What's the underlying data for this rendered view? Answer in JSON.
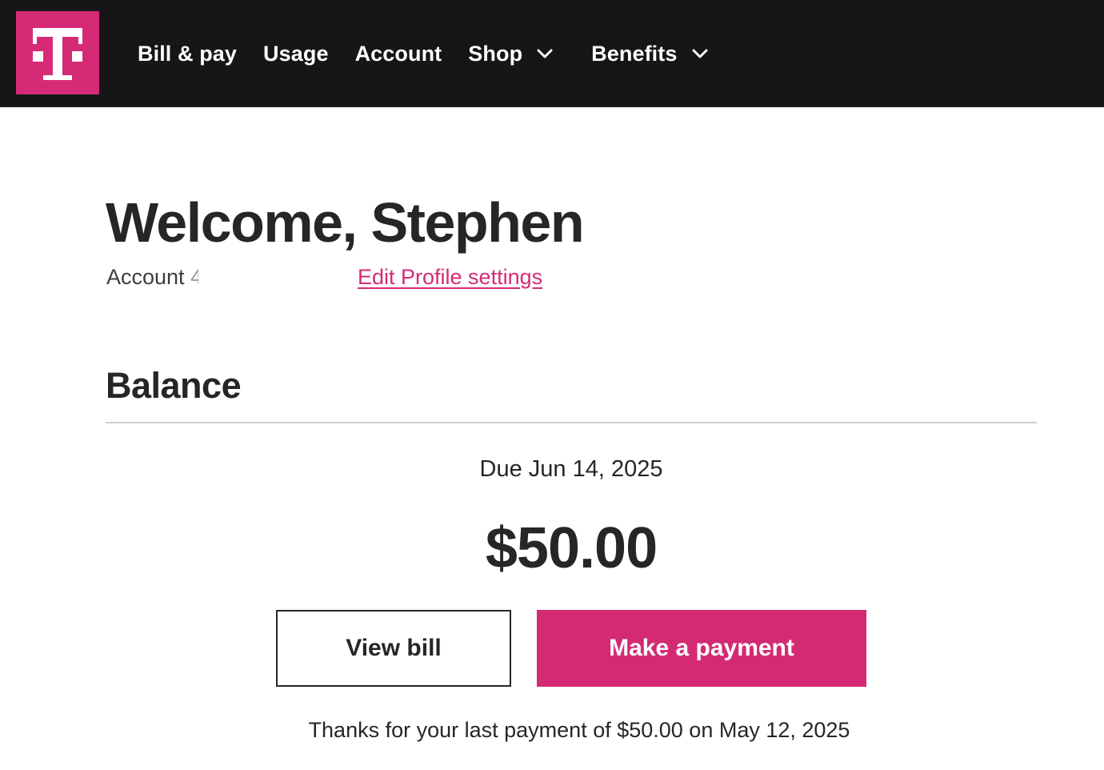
{
  "colors": {
    "brand_magenta": "#d62a77",
    "header_background": "#161616",
    "text_dark": "#262626",
    "divider": "#cfcfcf"
  },
  "header": {
    "logo_icon": "t-mobile-logo",
    "nav": {
      "bill_pay": "Bill & pay",
      "usage": "Usage",
      "account": "Account",
      "shop": "Shop",
      "benefits": "Benefits"
    },
    "dropdown_icon": "chevron-down-icon"
  },
  "welcome": {
    "title": "Welcome, Stephen",
    "account_label": "Account",
    "account_number_fragment": "4",
    "edit_profile_link": "Edit Profile settings"
  },
  "balance": {
    "heading": "Balance",
    "due_date": "Due Jun 14, 2025",
    "amount": "$50.00",
    "view_bill_button": "View bill",
    "make_payment_button": "Make a payment",
    "last_payment_note": "Thanks for your last payment of $50.00 on May 12, 2025"
  }
}
